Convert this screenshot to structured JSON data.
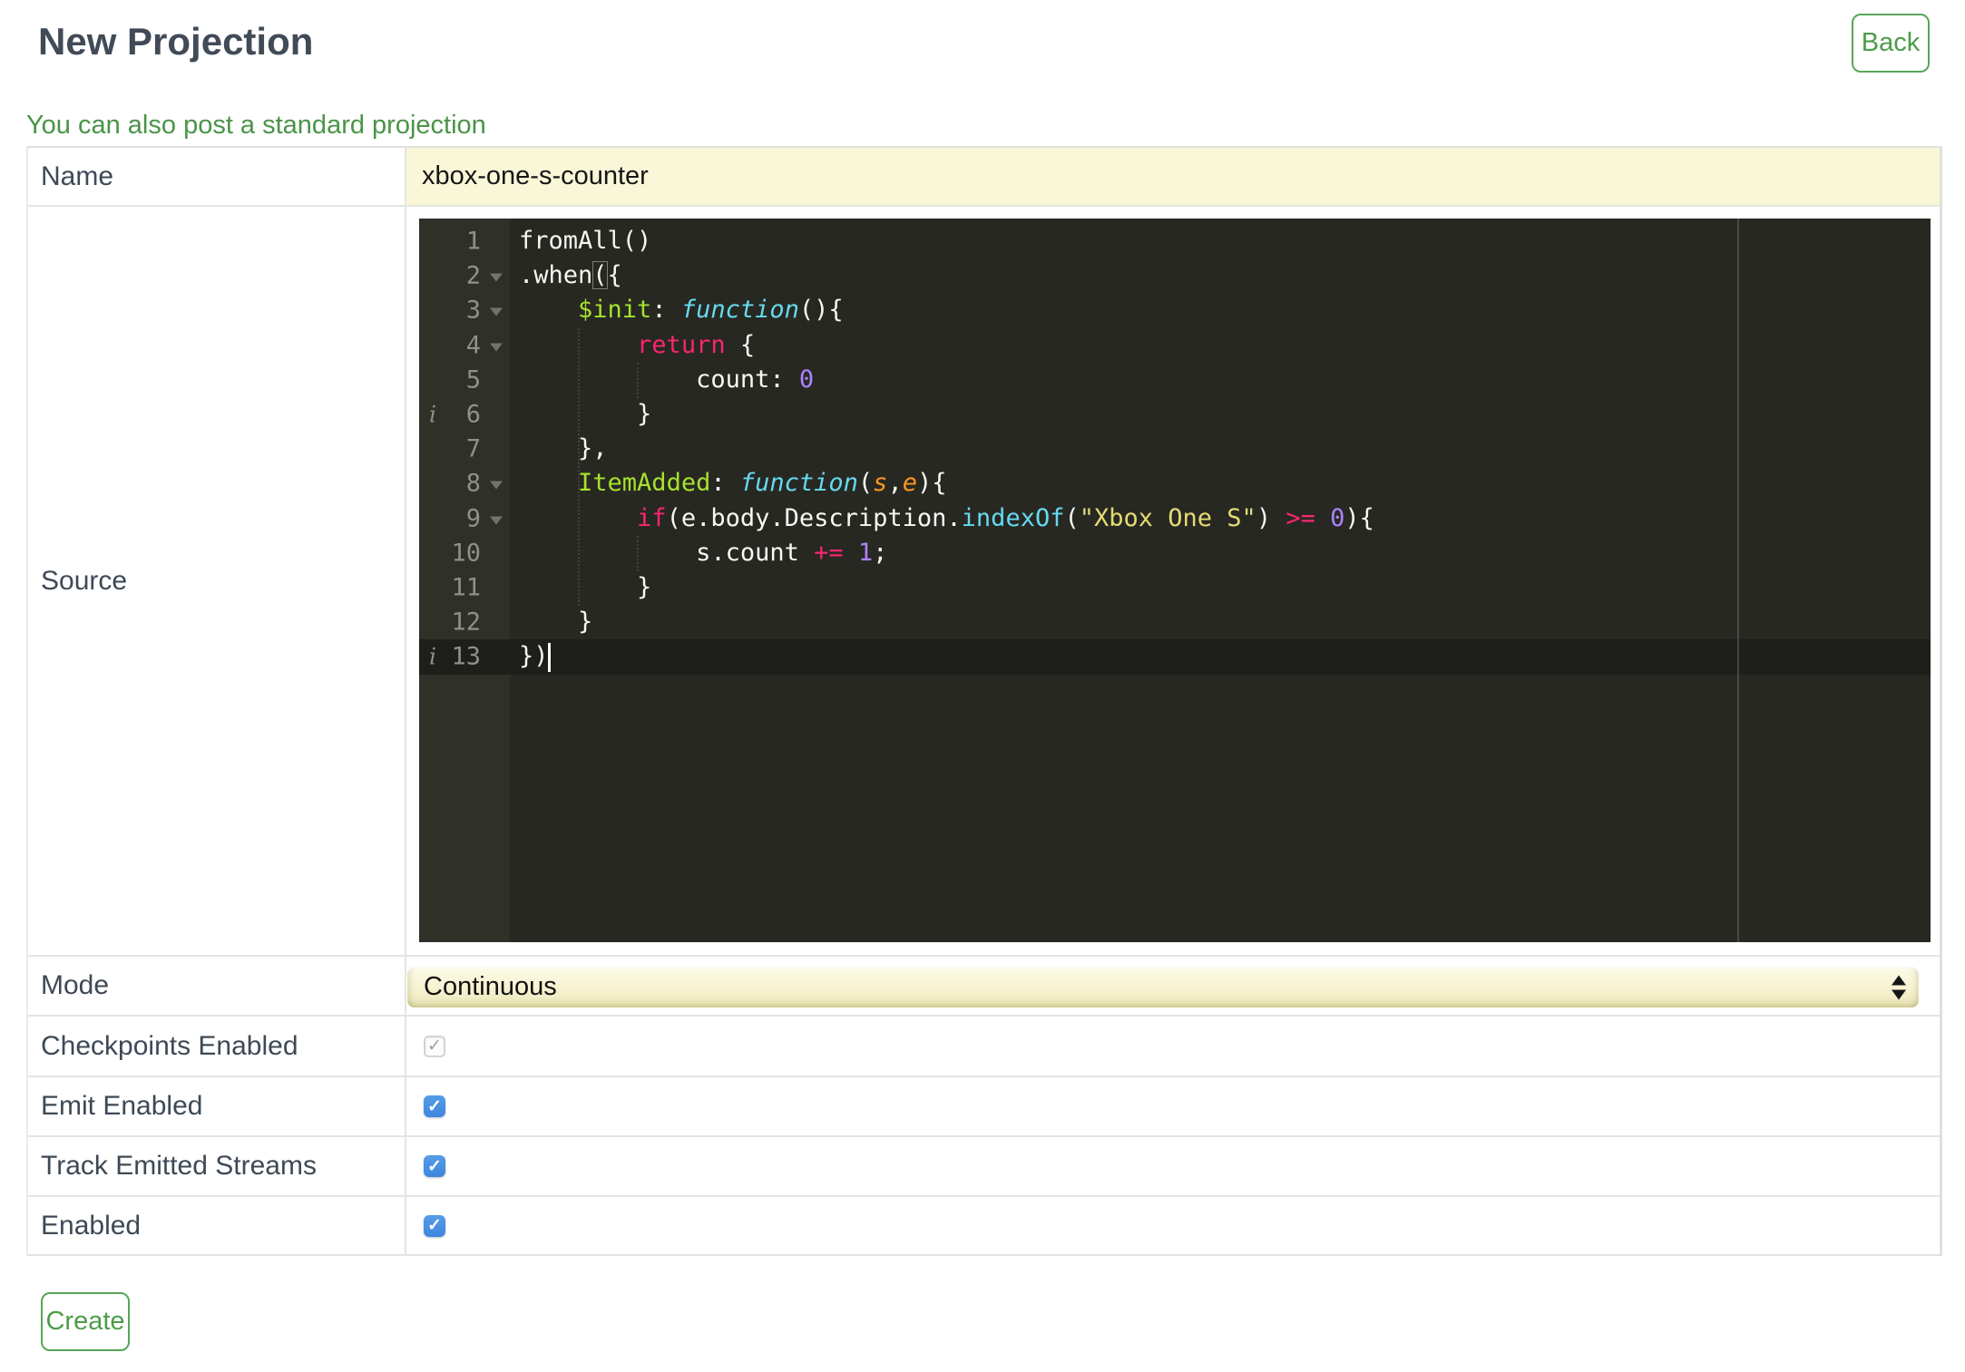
{
  "page": {
    "title": "New Projection",
    "back_label": "Back",
    "link_text": "You can also post a standard projection",
    "create_label": "Create"
  },
  "form": {
    "name": {
      "label": "Name",
      "value": "xbox-one-s-counter"
    },
    "source": {
      "label": "Source"
    },
    "mode": {
      "label": "Mode",
      "value": "Continuous"
    },
    "toggles": [
      {
        "label": "Checkpoints Enabled",
        "checked": true,
        "disabled": true
      },
      {
        "label": "Emit Enabled",
        "checked": true,
        "disabled": false
      },
      {
        "label": "Track Emitted Streams",
        "checked": true,
        "disabled": false
      },
      {
        "label": "Enabled",
        "checked": true,
        "disabled": false
      }
    ]
  },
  "icons": {
    "check_glyph": "✓",
    "info_glyph": "i",
    "select_stepper": "up-down-arrows"
  },
  "colors": {
    "heading": "#414b57",
    "label": "#3e4956",
    "link_green": "#4a9447",
    "button_green": "#4c9d49",
    "button_border_green": "#57a657",
    "input_yellow": "#faf7d8",
    "checkbox_blue": "#4a90e2",
    "editor_bg": "#272822",
    "editor_gutter_bg": "#2f3129",
    "editor_active_line": "#1e1e1b",
    "tok_keyword": "#f92672",
    "tok_name": "#a6e22e",
    "tok_function": "#66d9ef",
    "tok_param": "#fd971f",
    "tok_string": "#e6db74",
    "tok_number": "#ae81ff"
  },
  "editor": {
    "active_line": 13,
    "lines": [
      {
        "num": 1,
        "tokens": [
          [
            "p",
            "fromAll()"
          ]
        ]
      },
      {
        "num": 2,
        "fold": true,
        "tokens": [
          [
            "p",
            ".when"
          ],
          [
            "b",
            "("
          ],
          [
            "p",
            "{"
          ]
        ]
      },
      {
        "num": 3,
        "fold": true,
        "tokens": [
          [
            "p",
            "    "
          ],
          [
            "n",
            "$init"
          ],
          [
            "p",
            ": "
          ],
          [
            "f",
            "function"
          ],
          [
            "p",
            "(){"
          ]
        ]
      },
      {
        "num": 4,
        "fold": true,
        "tokens": [
          [
            "p",
            "        "
          ],
          [
            "k",
            "return"
          ],
          [
            "p",
            " {"
          ]
        ]
      },
      {
        "num": 5,
        "tokens": [
          [
            "p",
            "            count: "
          ],
          [
            "num",
            "0"
          ]
        ]
      },
      {
        "num": 6,
        "info": true,
        "tokens": [
          [
            "p",
            "        }"
          ]
        ]
      },
      {
        "num": 7,
        "tokens": [
          [
            "p",
            "    },"
          ]
        ]
      },
      {
        "num": 8,
        "fold": true,
        "tokens": [
          [
            "p",
            "    "
          ],
          [
            "n",
            "ItemAdded"
          ],
          [
            "p",
            ": "
          ],
          [
            "f",
            "function"
          ],
          [
            "p",
            "("
          ],
          [
            "pr",
            "s"
          ],
          [
            "p",
            ","
          ],
          [
            "pr",
            "e"
          ],
          [
            "p",
            "){"
          ]
        ]
      },
      {
        "num": 9,
        "fold": true,
        "tokens": [
          [
            "p",
            "        "
          ],
          [
            "k",
            "if"
          ],
          [
            "p",
            "(e.body.Description."
          ],
          [
            "sf",
            "indexOf"
          ],
          [
            "p",
            "("
          ],
          [
            "s",
            "\"Xbox One S\""
          ],
          [
            "p",
            ") "
          ],
          [
            "k",
            ">="
          ],
          [
            "p",
            " "
          ],
          [
            "num",
            "0"
          ],
          [
            "p",
            "){"
          ]
        ]
      },
      {
        "num": 10,
        "tokens": [
          [
            "p",
            "            s.count "
          ],
          [
            "k",
            "+="
          ],
          [
            "p",
            " "
          ],
          [
            "num",
            "1"
          ],
          [
            "p",
            ";"
          ]
        ]
      },
      {
        "num": 11,
        "tokens": [
          [
            "p",
            "        }"
          ]
        ]
      },
      {
        "num": 12,
        "tokens": [
          [
            "p",
            "    }"
          ]
        ]
      },
      {
        "num": 13,
        "info": true,
        "cursor": true,
        "tokens": [
          [
            "p",
            "})"
          ]
        ]
      }
    ]
  }
}
